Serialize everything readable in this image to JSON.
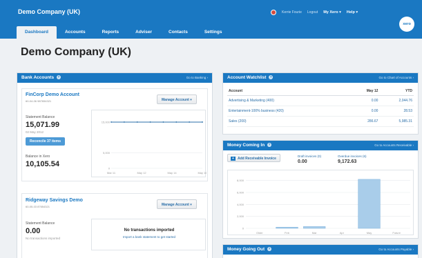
{
  "header": {
    "org": "Demo Company (UK)",
    "tabs": [
      "Dashboard",
      "Accounts",
      "Reports",
      "Adviser",
      "Contacts",
      "Settings"
    ],
    "user_name": "Kerrie Fourie",
    "logout": "Logout",
    "my_xero": "My Xero ▾",
    "help": "Help ▾",
    "logo": "xero"
  },
  "page_title": "Demo Company (UK)",
  "bank_accounts": {
    "title": "Bank Accounts",
    "go_link": "Go to Banking ›",
    "accounts": [
      {
        "name": "FinCorp Demo Account",
        "number": "60-04-06 987654321",
        "manage": "Manage Account ▾",
        "statement_label": "Statement Balance",
        "statement_value": "15,071.99",
        "statement_date": "02 May 2012",
        "reconcile": "Reconcile 37 items",
        "xero_label": "Balance in Xero",
        "xero_value": "10,105.54"
      },
      {
        "name": "Ridgeway Savings Demo",
        "number": "60-05-03 87654321",
        "manage": "Manage Account ▾",
        "statement_label": "Statement Balance",
        "statement_value": "0.00",
        "statement_note": "No transactions imported",
        "empty_title": "No transactions imported",
        "empty_link": "Import a bank statement to get started"
      }
    ]
  },
  "watchlist": {
    "title": "Account Watchlist",
    "go_link": "Go to Chart of Accounts ›",
    "columns": [
      "Account",
      "May 12",
      "YTD"
    ],
    "rows": [
      [
        "Advertising & Marketing (400)",
        "0.00",
        "2,044.76"
      ],
      [
        "Entertainment-100% business (420)",
        "0.00",
        "28.53"
      ],
      [
        "Sales (200)",
        "286.67",
        "5,985.31"
      ]
    ]
  },
  "money_in": {
    "title": "Money Coming In",
    "go_link": "Go to Accounts Receivable ›",
    "add_button": "Add Receivable Invoice",
    "draft_label": "Draft invoices (0)",
    "draft_value": "0.00",
    "overdue_label": "Overdue invoices (6)",
    "overdue_value": "9,172.63"
  },
  "money_out": {
    "title": "Money Going Out",
    "go_link": "Go to Accounts Payable ›"
  },
  "chart_data": [
    {
      "type": "line",
      "x": [
        "Mar 11",
        "May 12",
        "May 14",
        "May 16"
      ],
      "yticks": [
        "15,000",
        "5,000",
        "0"
      ],
      "ylim": [
        0,
        17000
      ],
      "series": [
        {
          "values": [
            15000,
            15000,
            15000,
            15000,
            15000,
            15000,
            15000,
            15000
          ]
        }
      ]
    },
    {
      "type": "bar",
      "categories": [
        "Older",
        "Feb",
        "Mar",
        "Apr",
        "May",
        "Future"
      ],
      "values": [
        0,
        200,
        300,
        0,
        8200,
        0
      ],
      "yticks": [
        "8,000",
        "6,000",
        "4,000",
        "2,000",
        "0"
      ],
      "ylim": [
        0,
        9000
      ]
    }
  ]
}
